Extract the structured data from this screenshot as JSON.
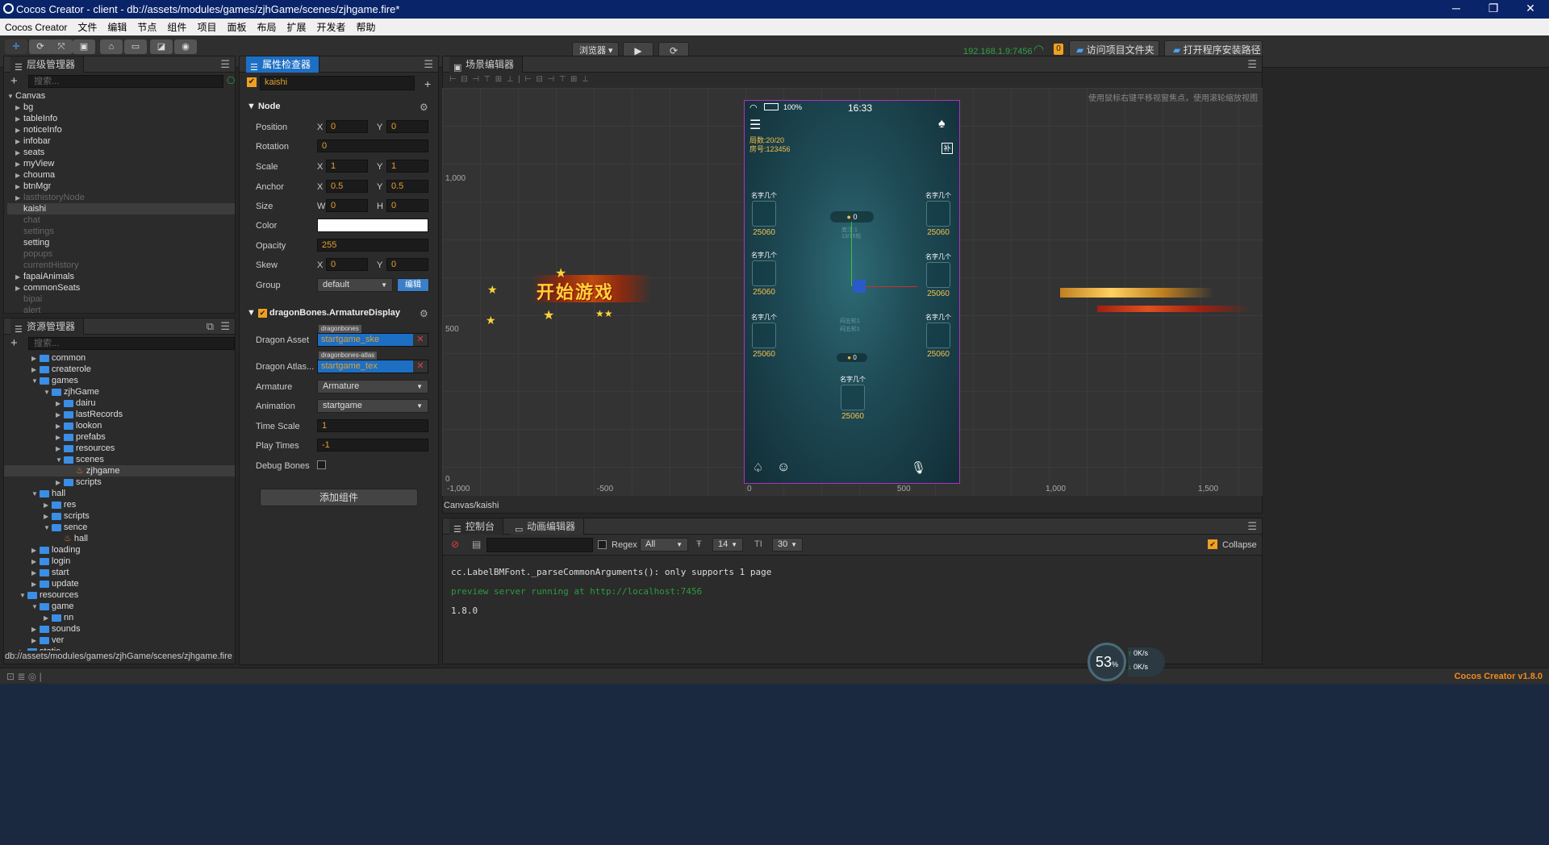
{
  "window": {
    "title": "Cocos Creator - client - db://assets/modules/games/zjhGame/scenes/zjhgame.fire*"
  },
  "menu": [
    "Cocos Creator",
    "文件",
    "编辑",
    "节点",
    "组件",
    "项目",
    "面板",
    "布局",
    "扩展",
    "开发者",
    "帮助"
  ],
  "toolbar": {
    "platform": "浏览器",
    "ip": "192.168.1.9:7456",
    "badge": "0",
    "open_project_folder": "访问项目文件夹",
    "open_install_path": "打开程序安装路径"
  },
  "hierarchy": {
    "title": "层级管理器",
    "search_placeholder": "搜索...",
    "root": "Canvas",
    "items": [
      {
        "label": "bg",
        "arrow": "▶",
        "dim": false
      },
      {
        "label": "tableInfo",
        "arrow": "▶",
        "dim": false
      },
      {
        "label": "noticeInfo",
        "arrow": "▶",
        "dim": false
      },
      {
        "label": "infobar",
        "arrow": "▶",
        "dim": false
      },
      {
        "label": "seats",
        "arrow": "▶",
        "dim": false
      },
      {
        "label": "myView",
        "arrow": "▶",
        "dim": false
      },
      {
        "label": "chouma",
        "arrow": "▶",
        "dim": false
      },
      {
        "label": "btnMgr",
        "arrow": "▶",
        "dim": false
      },
      {
        "label": "lasthistoryNode",
        "arrow": "▶",
        "dim": true
      },
      {
        "label": "kaishi",
        "arrow": "",
        "dim": false,
        "sel": true
      },
      {
        "label": "chat",
        "arrow": "",
        "dim": true
      },
      {
        "label": "settings",
        "arrow": "",
        "dim": true
      },
      {
        "label": "setting",
        "arrow": "",
        "dim": false
      },
      {
        "label": "popups",
        "arrow": "",
        "dim": true
      },
      {
        "label": "currentHistory",
        "arrow": "",
        "dim": true
      },
      {
        "label": "fapaiAnimals",
        "arrow": "▶",
        "dim": false
      },
      {
        "label": "commonSeats",
        "arrow": "▶",
        "dim": false
      },
      {
        "label": "bipai",
        "arrow": "",
        "dim": true
      },
      {
        "label": "alert",
        "arrow": "",
        "dim": true
      }
    ]
  },
  "assets": {
    "title": "资源管理器",
    "search_placeholder": "搜索...",
    "items": [
      {
        "label": "common",
        "indent": 2,
        "arrow": "▶",
        "type": "folder"
      },
      {
        "label": "createrole",
        "indent": 2,
        "arrow": "▶",
        "type": "folder"
      },
      {
        "label": "games",
        "indent": 2,
        "arrow": "▼",
        "type": "folder"
      },
      {
        "label": "zjhGame",
        "indent": 3,
        "arrow": "▼",
        "type": "folder"
      },
      {
        "label": "dairu",
        "indent": 4,
        "arrow": "▶",
        "type": "folder"
      },
      {
        "label": "lastRecords",
        "indent": 4,
        "arrow": "▶",
        "type": "folder"
      },
      {
        "label": "lookon",
        "indent": 4,
        "arrow": "▶",
        "type": "folder"
      },
      {
        "label": "prefabs",
        "indent": 4,
        "arrow": "▶",
        "type": "folder"
      },
      {
        "label": "resources",
        "indent": 4,
        "arrow": "▶",
        "type": "folder"
      },
      {
        "label": "scenes",
        "indent": 4,
        "arrow": "▼",
        "type": "folder"
      },
      {
        "label": "zjhgame",
        "indent": 5,
        "arrow": "",
        "type": "fire",
        "sel": true
      },
      {
        "label": "scripts",
        "indent": 4,
        "arrow": "▶",
        "type": "folder"
      },
      {
        "label": "hall",
        "indent": 2,
        "arrow": "▼",
        "type": "folder"
      },
      {
        "label": "res",
        "indent": 3,
        "arrow": "▶",
        "type": "folder"
      },
      {
        "label": "scripts",
        "indent": 3,
        "arrow": "▶",
        "type": "folder"
      },
      {
        "label": "sence",
        "indent": 3,
        "arrow": "▼",
        "type": "folder"
      },
      {
        "label": "hall",
        "indent": 4,
        "arrow": "",
        "type": "fire"
      },
      {
        "label": "loading",
        "indent": 2,
        "arrow": "▶",
        "type": "folder"
      },
      {
        "label": "login",
        "indent": 2,
        "arrow": "▶",
        "type": "folder"
      },
      {
        "label": "start",
        "indent": 2,
        "arrow": "▶",
        "type": "folder"
      },
      {
        "label": "update",
        "indent": 2,
        "arrow": "▶",
        "type": "folder"
      },
      {
        "label": "resources",
        "indent": 1,
        "arrow": "▼",
        "type": "folder"
      },
      {
        "label": "game",
        "indent": 2,
        "arrow": "▼",
        "type": "folder"
      },
      {
        "label": "nn",
        "indent": 3,
        "arrow": "▶",
        "type": "folder"
      },
      {
        "label": "sounds",
        "indent": 2,
        "arrow": "▶",
        "type": "folder"
      },
      {
        "label": "ver",
        "indent": 2,
        "arrow": "▶",
        "type": "folder"
      },
      {
        "label": "static",
        "indent": 1,
        "arrow": "▶",
        "type": "folder"
      }
    ],
    "footer_path": "db://assets/modules/games/zjhGame/scenes/zjhgame.fire"
  },
  "inspector": {
    "title": "属性检查器",
    "node_name": "kaishi",
    "node_section": "Node",
    "position": {
      "label": "Position",
      "x": "0",
      "y": "0"
    },
    "rotation": {
      "label": "Rotation",
      "v": "0"
    },
    "scale": {
      "label": "Scale",
      "x": "1",
      "y": "1"
    },
    "anchor": {
      "label": "Anchor",
      "x": "0.5",
      "y": "0.5"
    },
    "size": {
      "label": "Size",
      "w": "0",
      "h": "0"
    },
    "color": {
      "label": "Color"
    },
    "opacity": {
      "label": "Opacity",
      "v": "255"
    },
    "skew": {
      "label": "Skew",
      "x": "0",
      "y": "0"
    },
    "group": {
      "label": "Group",
      "v": "default",
      "edit": "编辑"
    },
    "xl": "X",
    "yl": "Y",
    "wl": "W",
    "hl": "H",
    "db_section": "dragonBones.ArmatureDisplay",
    "dragon_asset": {
      "label": "Dragon Asset",
      "tag": "dragonbones",
      "v": "startgame_ske"
    },
    "dragon_atlas": {
      "label": "Dragon Atlas...",
      "tag": "dragonbones-atlas",
      "v": "startgame_tex"
    },
    "armature": {
      "label": "Armature",
      "v": "Armature"
    },
    "animation": {
      "label": "Animation",
      "v": "startgame"
    },
    "time_scale": {
      "label": "Time Scale",
      "v": "1"
    },
    "play_times": {
      "label": "Play Times",
      "v": "-1"
    },
    "debug_bones": {
      "label": "Debug Bones"
    },
    "add_component": "添加组件"
  },
  "scene": {
    "title": "场景编辑器",
    "hint": "使用鼠标右键平移视窗焦点，使用滚轮缩放视图",
    "path": "Canvas/kaishi",
    "y_ticks": [
      "1,000",
      "500",
      "0"
    ],
    "x_ticks": [
      "-1,000",
      "-500",
      "0",
      "500",
      "1,000",
      "1,500"
    ],
    "banner": "开始游戏",
    "phone": {
      "battery": "100%",
      "time": "16:33",
      "round": "局数:20/20",
      "room": "房号:123456",
      "seat_name": "名字几个",
      "seat_score": "25060",
      "pot": "0",
      "pot2": "0",
      "info1": "底注:1",
      "info2": "13/15轮",
      "mid1": "闷五轮1",
      "mid2": "闷五轮1",
      "bu": "补"
    }
  },
  "console": {
    "tab_console": "控制台",
    "tab_anim": "动画编辑器",
    "regex": "Regex",
    "filter": "All",
    "font_size": "14",
    "line_height": "30",
    "collapse": "Collapse",
    "lines": [
      {
        "text": "cc.LabelBMFont._parseCommonArguments(): only supports 1 page",
        "color": "#dddddd"
      },
      {
        "text": "preview server running at http://localhost:7456",
        "color": "#2e9a3e"
      },
      {
        "text": "1.8.0",
        "color": "#dddddd"
      }
    ]
  },
  "status": {
    "version": "Cocos Creator v1.8.0",
    "cpu": "53",
    "cpu_unit": "%",
    "up": "0K/s",
    "down": "0K/s"
  },
  "colors": {
    "accent": "#1d6fc4",
    "ip": "#2ea043",
    "warn": "#f0a020"
  }
}
